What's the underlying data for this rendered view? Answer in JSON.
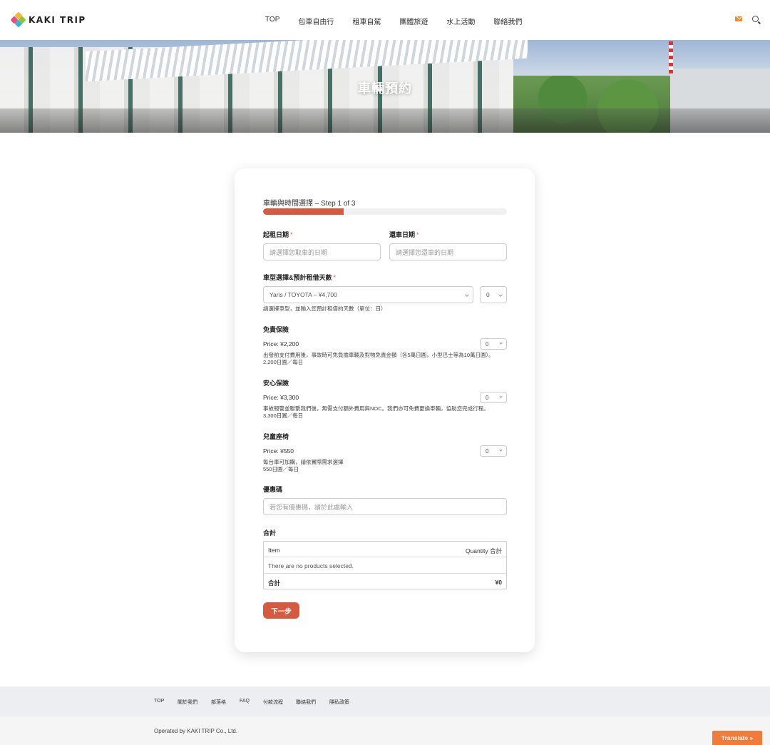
{
  "header": {
    "logo_text": "KAKI TRIP",
    "nav": [
      "TOP",
      "包車自由行",
      "租車自駕",
      "團體旅遊",
      "水上活動",
      "聯絡我們"
    ]
  },
  "hero": {
    "title": "車輛預約"
  },
  "form": {
    "step_title": "車輛與時間選擇 – Step 1 of 3",
    "progress": 0.33,
    "pickup_label": "起租日期",
    "pickup_placeholder": "請選擇您取車的日期",
    "return_label": "還車日期",
    "return_placeholder": "請選擇您還車的日期",
    "required_mark": "*",
    "vehicle_label": "車型選擇&預計租借天數",
    "vehicle_value": "Yaris / TOYOTA – ¥4,700",
    "vehicle_days": "0",
    "vehicle_help": "請選擇車型，並輸入您預計租借的天數（單位：日）",
    "insurance1": {
      "title": "免責保險",
      "price": "Price: ¥2,200",
      "qty": "0",
      "desc1": "出發前支付費用後，事故時可免負擔車輛及對物免責金額（各5萬日圓，小型巴士等為10萬日圓）。",
      "desc2": "2,200日圓／每日"
    },
    "insurance2": {
      "title": "安心保險",
      "price": "Price: ¥3,300",
      "qty": "0",
      "desc1": "事故報警並聯繫我們後，無需支付額外費用與NOC。我們亦可免費更換車輛，協助您完成行程。",
      "desc2": "3,300日圓／每日"
    },
    "childseat": {
      "title": "兒童座椅",
      "price": "Price: ¥550",
      "qty": "0",
      "desc1": "每台車可加購，請依實際需求選擇",
      "desc2": "550日圓／每日"
    },
    "coupon_label": "優惠碼",
    "coupon_placeholder": "若您有優惠碼，請於此處輸入",
    "total_label": "合計",
    "table": {
      "col_item": "Item",
      "col_qty": "Quantity",
      "col_total": "合計",
      "empty": "There are no products selected.",
      "footer_label": "合計",
      "footer_value": "¥0"
    },
    "next_button": "下一步"
  },
  "footer": {
    "links": [
      "TOP",
      "關於我們",
      "部落格",
      "FAQ",
      "付款流程",
      "聯絡我們",
      "隱私政策"
    ],
    "copyright": "Operated by KAKI TRIP Co., Ltd.",
    "translate": "Translate »"
  },
  "colors": {
    "accent": "#d55a3f",
    "mail_icon": "#f08a2c",
    "translate_bg": "#f07b3b"
  }
}
